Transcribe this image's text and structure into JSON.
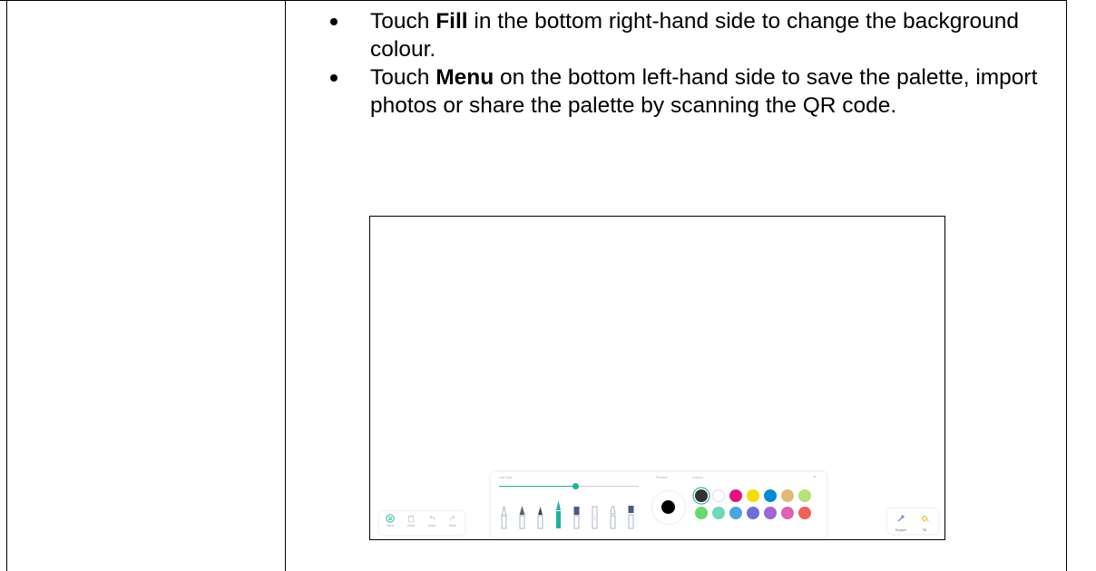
{
  "instructions": [
    {
      "prefix": "Touch ",
      "bold": "Fill",
      "rest": " in the bottom right-hand side to change the background colour."
    },
    {
      "prefix": "Touch ",
      "bold": "Menu",
      "rest": " on the bottom left-hand side to save the palette, import photos or share the palette by scanning the QR code."
    }
  ],
  "screenshot": {
    "left_toolbar": [
      {
        "label": "Menu",
        "icon": "menu-circle-icon",
        "color": "#1fb39b"
      },
      {
        "label": "Clear",
        "icon": "trash-icon",
        "color": "#c8cdd2"
      },
      {
        "label": "Undo",
        "icon": "undo-icon",
        "color": "#c8cdd2"
      },
      {
        "label": "Redo",
        "icon": "redo-icon",
        "color": "#c8cdd2"
      }
    ],
    "panel": {
      "thickness_label": "Line Size",
      "preview_label": "Preview",
      "colours_label": "Colours",
      "thickness_fraction": 0.55,
      "swatches": [
        "#333333",
        "#ffffff",
        "#e4127f",
        "#f6dd00",
        "#008ad6",
        "#e3b77a",
        "#b6e07a",
        "#67d96f",
        "#6fd9b7",
        "#47a9df",
        "#6c6fd6",
        "#a066d3",
        "#dd62b4",
        "#f2605a"
      ]
    },
    "right_toolbar": [
      {
        "label": "Dropper",
        "icon": "eyedropper-icon",
        "color": "#4a63d6"
      },
      {
        "label": "Fill",
        "icon": "fill-bucket-icon",
        "color": "#f0b030"
      }
    ]
  }
}
